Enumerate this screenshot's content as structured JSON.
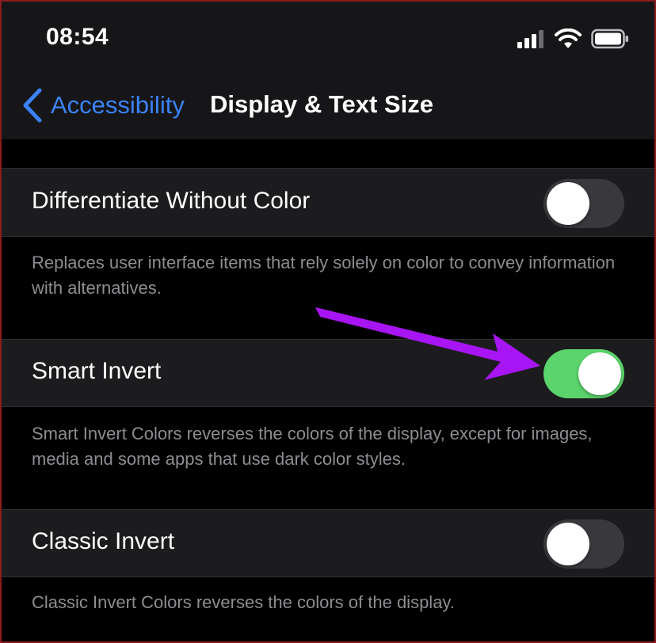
{
  "status": {
    "time": "08:54"
  },
  "nav": {
    "back_label": "Accessibility",
    "title": "Display & Text Size"
  },
  "rows": [
    {
      "label": "Differentiate Without Color",
      "footer": "Replaces user interface items that rely solely on color to convey information with alternatives.",
      "toggle_on": false
    },
    {
      "label": "Smart Invert",
      "footer": "Smart Invert Colors reverses the colors of the display, except for images, media and some apps that use dark color styles.",
      "toggle_on": true
    },
    {
      "label": "Classic Invert",
      "footer": "Classic Invert Colors reverses the colors of the display.",
      "toggle_on": false
    }
  ],
  "colors": {
    "accent": "#3b82f6",
    "toggle_on": "#5bd46b",
    "annotation_arrow": "#a815f5"
  }
}
